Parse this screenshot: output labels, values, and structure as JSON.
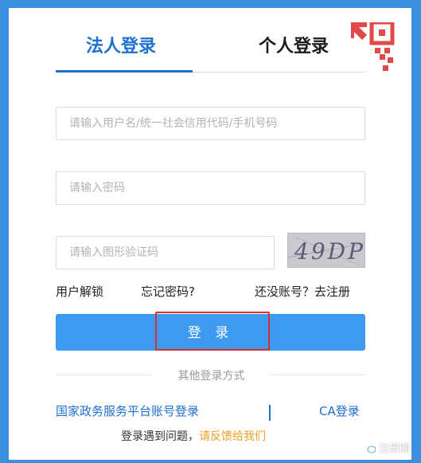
{
  "tabs": {
    "legal": "法人登录",
    "personal": "个人登录"
  },
  "form": {
    "username_placeholder": "请输入用户名/统一社会信用代码/手机号码",
    "password_placeholder": "请输入密码",
    "captcha_placeholder": "请输入图形验证码",
    "captcha_text": "49DP"
  },
  "links": {
    "unlock": "用户解锁",
    "forgot": "忘记密码?",
    "register": "还没账号？去注册"
  },
  "login_button": "登 录",
  "other": {
    "title": "其他登录方式",
    "gov": "国家政务服务平台账号登录",
    "ca": "CA登录"
  },
  "problem": {
    "prefix": "登录遇到问题，",
    "feedback": "请反馈给我们"
  },
  "watermark": "注册圈",
  "colors": {
    "background": "#3a8fe0",
    "accent": "#1d6fd0",
    "button": "#3d9af0",
    "highlight": "#d9302c",
    "feedback": "#f0a020"
  }
}
